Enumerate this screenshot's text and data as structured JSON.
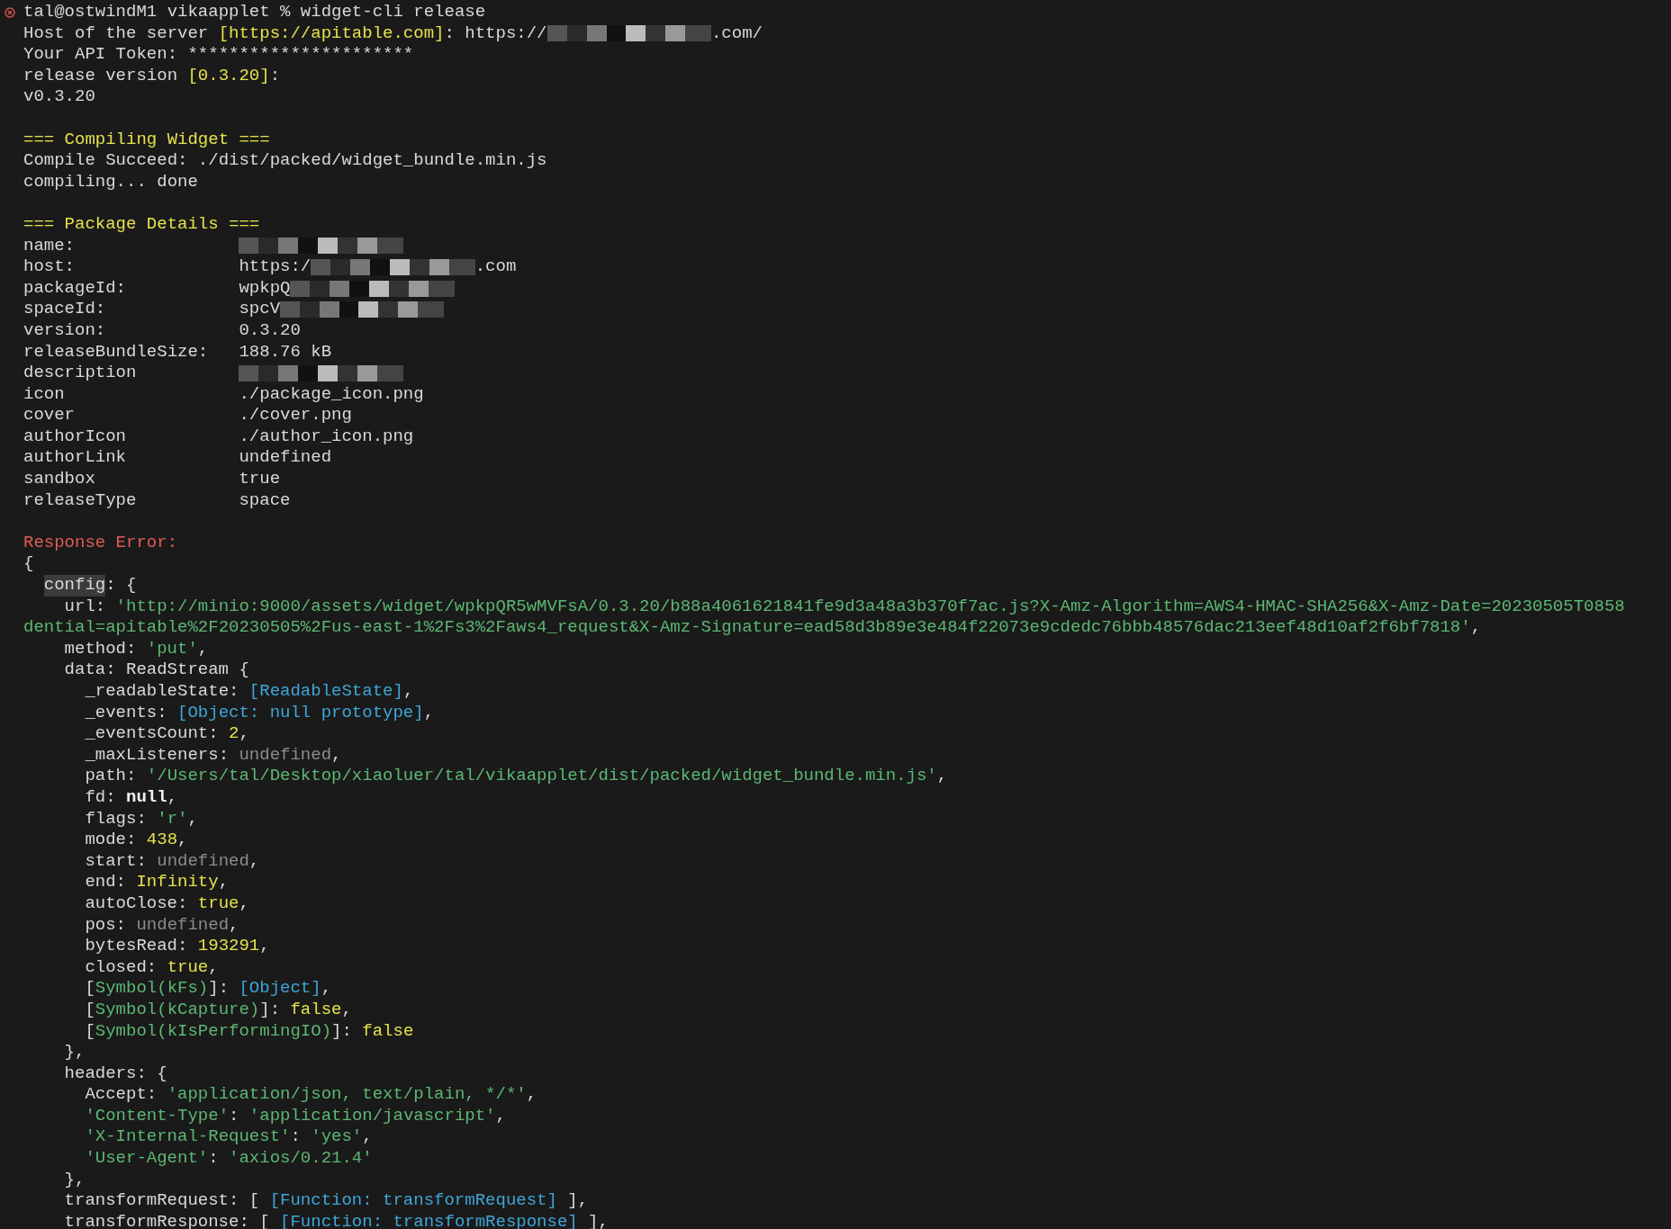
{
  "terminal": {
    "lines": [
      {
        "kind": "prompt",
        "segments": [
          {
            "kind": "plain",
            "text": "tal@ostwindM1 vikaapplet % widget-cli release"
          }
        ]
      },
      {
        "kind": "text",
        "segments": [
          {
            "kind": "plain",
            "text": "Host of the server "
          },
          {
            "kind": "yellow",
            "text": "[https://apitable.com]"
          },
          {
            "kind": "plain",
            "text": ": https://"
          },
          {
            "kind": "redaction"
          },
          {
            "kind": "plain",
            "text": ".com/"
          }
        ]
      },
      {
        "kind": "text",
        "segments": [
          {
            "kind": "plain",
            "text": "Your API Token: **********************"
          }
        ]
      },
      {
        "kind": "text",
        "segments": [
          {
            "kind": "plain",
            "text": "release version "
          },
          {
            "kind": "yellow",
            "text": "[0.3.20]"
          },
          {
            "kind": "plain",
            "text": ":"
          }
        ]
      },
      {
        "kind": "text",
        "segments": [
          {
            "kind": "plain",
            "text": "v0.3.20"
          }
        ]
      },
      {
        "kind": "blank"
      },
      {
        "kind": "text",
        "segments": [
          {
            "kind": "yellow",
            "text": "=== Compiling Widget ==="
          }
        ]
      },
      {
        "kind": "text",
        "segments": [
          {
            "kind": "plain",
            "text": "Compile Succeed: ./dist/packed/widget_bundle.min.js"
          }
        ]
      },
      {
        "kind": "text",
        "segments": [
          {
            "kind": "plain",
            "text": "compiling... done"
          }
        ]
      },
      {
        "kind": "blank"
      },
      {
        "kind": "text",
        "segments": [
          {
            "kind": "yellow",
            "text": "=== Package Details ==="
          }
        ]
      },
      {
        "kind": "pair",
        "key": "name:",
        "value": [
          {
            "kind": "redaction"
          }
        ]
      },
      {
        "kind": "pair",
        "key": "host:",
        "value": [
          {
            "kind": "plain",
            "text": "https:/"
          },
          {
            "kind": "redaction"
          },
          {
            "kind": "plain",
            "text": ".com"
          }
        ]
      },
      {
        "kind": "pair",
        "key": "packageId:",
        "value": [
          {
            "kind": "plain",
            "text": "wpkpQ"
          },
          {
            "kind": "redaction"
          }
        ]
      },
      {
        "kind": "pair",
        "key": "spaceId:",
        "value": [
          {
            "kind": "plain",
            "text": "spcV"
          },
          {
            "kind": "redaction"
          }
        ]
      },
      {
        "kind": "pair",
        "key": "version:",
        "value": [
          {
            "kind": "plain",
            "text": "0.3.20"
          }
        ]
      },
      {
        "kind": "pair",
        "key": "releaseBundleSize:",
        "value": [
          {
            "kind": "plain",
            "text": "188.76 kB"
          }
        ]
      },
      {
        "kind": "pair",
        "key": "description",
        "value": [
          {
            "kind": "redaction"
          }
        ]
      },
      {
        "kind": "pair",
        "key": "icon",
        "value": [
          {
            "kind": "plain",
            "text": "./package_icon.png"
          }
        ]
      },
      {
        "kind": "pair",
        "key": "cover",
        "value": [
          {
            "kind": "plain",
            "text": "./cover.png"
          }
        ]
      },
      {
        "kind": "pair",
        "key": "authorIcon",
        "value": [
          {
            "kind": "plain",
            "text": "./author_icon.png"
          }
        ]
      },
      {
        "kind": "pair",
        "key": "authorLink",
        "value": [
          {
            "kind": "plain",
            "text": "undefined"
          }
        ]
      },
      {
        "kind": "pair",
        "key": "sandbox",
        "value": [
          {
            "kind": "plain",
            "text": "true"
          }
        ]
      },
      {
        "kind": "pair",
        "key": "releaseType",
        "value": [
          {
            "kind": "plain",
            "text": "space"
          }
        ]
      },
      {
        "kind": "blank"
      },
      {
        "kind": "text",
        "segments": [
          {
            "kind": "red",
            "text": "Response Error:"
          }
        ]
      },
      {
        "kind": "text",
        "segments": [
          {
            "kind": "plain",
            "text": "{"
          }
        ]
      },
      {
        "kind": "text",
        "segments": [
          {
            "kind": "highlight",
            "text": "  config"
          },
          {
            "kind": "plain",
            "text": ": {"
          }
        ]
      },
      {
        "kind": "text",
        "segments": [
          {
            "kind": "plain",
            "text": "    url: "
          },
          {
            "kind": "green",
            "text": "'http://minio:9000/assets/widget/wpkpQR5wMVFsA/0.3.20/b88a4061621841fe9d3a48a3b370f7ac.js?X-Amz-Algorithm=AWS4-HMAC-SHA256&X-Amz-Date=20230505T0858"
          }
        ]
      },
      {
        "kind": "text",
        "segments": [
          {
            "kind": "green",
            "text": "dential=apitable%2F20230505%2Fus-east-1%2Fs3%2Faws4_request&X-Amz-Signature=ead58d3b89e3e484f22073e9cdedc76bbb48576dac213eef48d10af2f6bf7818'"
          },
          {
            "kind": "plain",
            "text": ","
          }
        ]
      },
      {
        "kind": "text",
        "segments": [
          {
            "kind": "plain",
            "text": "    method: "
          },
          {
            "kind": "green",
            "text": "'put'"
          },
          {
            "kind": "plain",
            "text": ","
          }
        ]
      },
      {
        "kind": "text",
        "segments": [
          {
            "kind": "plain",
            "text": "    data: ReadStream {"
          }
        ]
      },
      {
        "kind": "text",
        "segments": [
          {
            "kind": "plain",
            "text": "      _readableState: "
          },
          {
            "kind": "blue",
            "text": "[ReadableState]"
          },
          {
            "kind": "plain",
            "text": ","
          }
        ]
      },
      {
        "kind": "text",
        "segments": [
          {
            "kind": "plain",
            "text": "      _events: "
          },
          {
            "kind": "blue",
            "text": "[Object: null prototype]"
          },
          {
            "kind": "plain",
            "text": ","
          }
        ]
      },
      {
        "kind": "text",
        "segments": [
          {
            "kind": "plain",
            "text": "      _eventsCount: "
          },
          {
            "kind": "yellow",
            "text": "2"
          },
          {
            "kind": "plain",
            "text": ","
          }
        ]
      },
      {
        "kind": "text",
        "segments": [
          {
            "kind": "plain",
            "text": "      _maxListeners: "
          },
          {
            "kind": "dim",
            "text": "undefined"
          },
          {
            "kind": "plain",
            "text": ","
          }
        ]
      },
      {
        "kind": "text",
        "segments": [
          {
            "kind": "plain",
            "text": "      path: "
          },
          {
            "kind": "green",
            "text": "'/Users/tal/Desktop/xiaoluer/tal/vikaapplet/dist/packed/widget_bundle.min.js'"
          },
          {
            "kind": "plain",
            "text": ","
          }
        ]
      },
      {
        "kind": "text",
        "segments": [
          {
            "kind": "plain",
            "text": "      fd: "
          },
          {
            "kind": "bold",
            "text": "null"
          },
          {
            "kind": "plain",
            "text": ","
          }
        ]
      },
      {
        "kind": "text",
        "segments": [
          {
            "kind": "plain",
            "text": "      flags: "
          },
          {
            "kind": "green",
            "text": "'r'"
          },
          {
            "kind": "plain",
            "text": ","
          }
        ]
      },
      {
        "kind": "text",
        "segments": [
          {
            "kind": "plain",
            "text": "      mode: "
          },
          {
            "kind": "yellow",
            "text": "438"
          },
          {
            "kind": "plain",
            "text": ","
          }
        ]
      },
      {
        "kind": "text",
        "segments": [
          {
            "kind": "plain",
            "text": "      start: "
          },
          {
            "kind": "dim",
            "text": "undefined"
          },
          {
            "kind": "plain",
            "text": ","
          }
        ]
      },
      {
        "kind": "text",
        "segments": [
          {
            "kind": "plain",
            "text": "      end: "
          },
          {
            "kind": "yellow",
            "text": "Infinity"
          },
          {
            "kind": "plain",
            "text": ","
          }
        ]
      },
      {
        "kind": "text",
        "segments": [
          {
            "kind": "plain",
            "text": "      autoClose: "
          },
          {
            "kind": "yellow",
            "text": "true"
          },
          {
            "kind": "plain",
            "text": ","
          }
        ]
      },
      {
        "kind": "text",
        "segments": [
          {
            "kind": "plain",
            "text": "      pos: "
          },
          {
            "kind": "dim",
            "text": "undefined"
          },
          {
            "kind": "plain",
            "text": ","
          }
        ]
      },
      {
        "kind": "text",
        "segments": [
          {
            "kind": "plain",
            "text": "      bytesRead: "
          },
          {
            "kind": "yellow",
            "text": "193291"
          },
          {
            "kind": "plain",
            "text": ","
          }
        ]
      },
      {
        "kind": "text",
        "segments": [
          {
            "kind": "plain",
            "text": "      closed: "
          },
          {
            "kind": "yellow",
            "text": "true"
          },
          {
            "kind": "plain",
            "text": ","
          }
        ]
      },
      {
        "kind": "text",
        "segments": [
          {
            "kind": "plain",
            "text": "      ["
          },
          {
            "kind": "green",
            "text": "Symbol(kFs)"
          },
          {
            "kind": "plain",
            "text": "]: "
          },
          {
            "kind": "blue",
            "text": "[Object]"
          },
          {
            "kind": "plain",
            "text": ","
          }
        ]
      },
      {
        "kind": "text",
        "segments": [
          {
            "kind": "plain",
            "text": "      ["
          },
          {
            "kind": "green",
            "text": "Symbol(kCapture)"
          },
          {
            "kind": "plain",
            "text": "]: "
          },
          {
            "kind": "yellow",
            "text": "false"
          },
          {
            "kind": "plain",
            "text": ","
          }
        ]
      },
      {
        "kind": "text",
        "segments": [
          {
            "kind": "plain",
            "text": "      ["
          },
          {
            "kind": "green",
            "text": "Symbol(kIsPerformingIO)"
          },
          {
            "kind": "plain",
            "text": "]: "
          },
          {
            "kind": "yellow",
            "text": "false"
          }
        ]
      },
      {
        "kind": "text",
        "segments": [
          {
            "kind": "plain",
            "text": "    },"
          }
        ]
      },
      {
        "kind": "text",
        "segments": [
          {
            "kind": "plain",
            "text": "    headers: {"
          }
        ]
      },
      {
        "kind": "text",
        "segments": [
          {
            "kind": "plain",
            "text": "      Accept: "
          },
          {
            "kind": "green",
            "text": "'application/json, text/plain, */*'"
          },
          {
            "kind": "plain",
            "text": ","
          }
        ]
      },
      {
        "kind": "text",
        "segments": [
          {
            "kind": "green",
            "text": "      'Content-Type'"
          },
          {
            "kind": "plain",
            "text": ": "
          },
          {
            "kind": "green",
            "text": "'application/javascript'"
          },
          {
            "kind": "plain",
            "text": ","
          }
        ]
      },
      {
        "kind": "text",
        "segments": [
          {
            "kind": "green",
            "text": "      'X-Internal-Request'"
          },
          {
            "kind": "plain",
            "text": ": "
          },
          {
            "kind": "green",
            "text": "'yes'"
          },
          {
            "kind": "plain",
            "text": ","
          }
        ]
      },
      {
        "kind": "text",
        "segments": [
          {
            "kind": "green",
            "text": "      'User-Agent'"
          },
          {
            "kind": "plain",
            "text": ": "
          },
          {
            "kind": "green",
            "text": "'axios/0.21.4'"
          }
        ]
      },
      {
        "kind": "text",
        "segments": [
          {
            "kind": "plain",
            "text": "    },"
          }
        ]
      },
      {
        "kind": "text",
        "segments": [
          {
            "kind": "plain",
            "text": "    transformRequest: [ "
          },
          {
            "kind": "blue",
            "text": "[Function: transformRequest]"
          },
          {
            "kind": "plain",
            "text": " ],"
          }
        ]
      },
      {
        "kind": "text",
        "segments": [
          {
            "kind": "plain",
            "text": "    transformResponse: [ "
          },
          {
            "kind": "blue",
            "text": "[Function: transformResponse]"
          },
          {
            "kind": "plain",
            "text": " ],"
          }
        ]
      }
    ]
  }
}
